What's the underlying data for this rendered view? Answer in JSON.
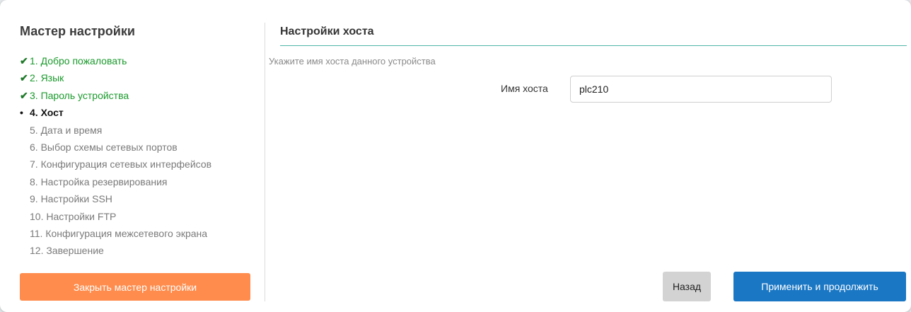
{
  "sidebar": {
    "title": "Мастер настройки",
    "steps": [
      {
        "label": "1. Добро пожаловать",
        "state": "done",
        "marker": "✔"
      },
      {
        "label": "2. Язык",
        "state": "done",
        "marker": "✔"
      },
      {
        "label": "3. Пароль устройства",
        "state": "done",
        "marker": "✔"
      },
      {
        "label": "4. Хост",
        "state": "current",
        "marker": "•"
      },
      {
        "label": "5. Дата и время",
        "state": "pending",
        "marker": ""
      },
      {
        "label": "6. Выбор схемы сетевых портов",
        "state": "pending",
        "marker": ""
      },
      {
        "label": "7. Конфигурация сетевых интерфейсов",
        "state": "pending",
        "marker": ""
      },
      {
        "label": "8. Настройка резервирования",
        "state": "pending",
        "marker": ""
      },
      {
        "label": "9. Настройки SSH",
        "state": "pending",
        "marker": ""
      },
      {
        "label": "10. Настройки FTP",
        "state": "pending",
        "marker": ""
      },
      {
        "label": "11. Конфигурация межсетевого экрана",
        "state": "pending",
        "marker": ""
      },
      {
        "label": "12. Завершение",
        "state": "pending",
        "marker": ""
      }
    ],
    "close_button": "Закрыть мастер настройки"
  },
  "main": {
    "title": "Настройки хоста",
    "hint": "Укажите имя хоста данного устройства",
    "hostname_label": "Имя хоста",
    "hostname_value": "plc210",
    "back_button": "Назад",
    "apply_button": "Применить и продолжить"
  },
  "colors": {
    "done": "#1a9a2c",
    "pending": "#7a7a7a",
    "accent_line": "#4fb6a8",
    "close_button": "#ff8c4c",
    "apply_button": "#1a77c4",
    "back_button": "#d3d3d3"
  }
}
